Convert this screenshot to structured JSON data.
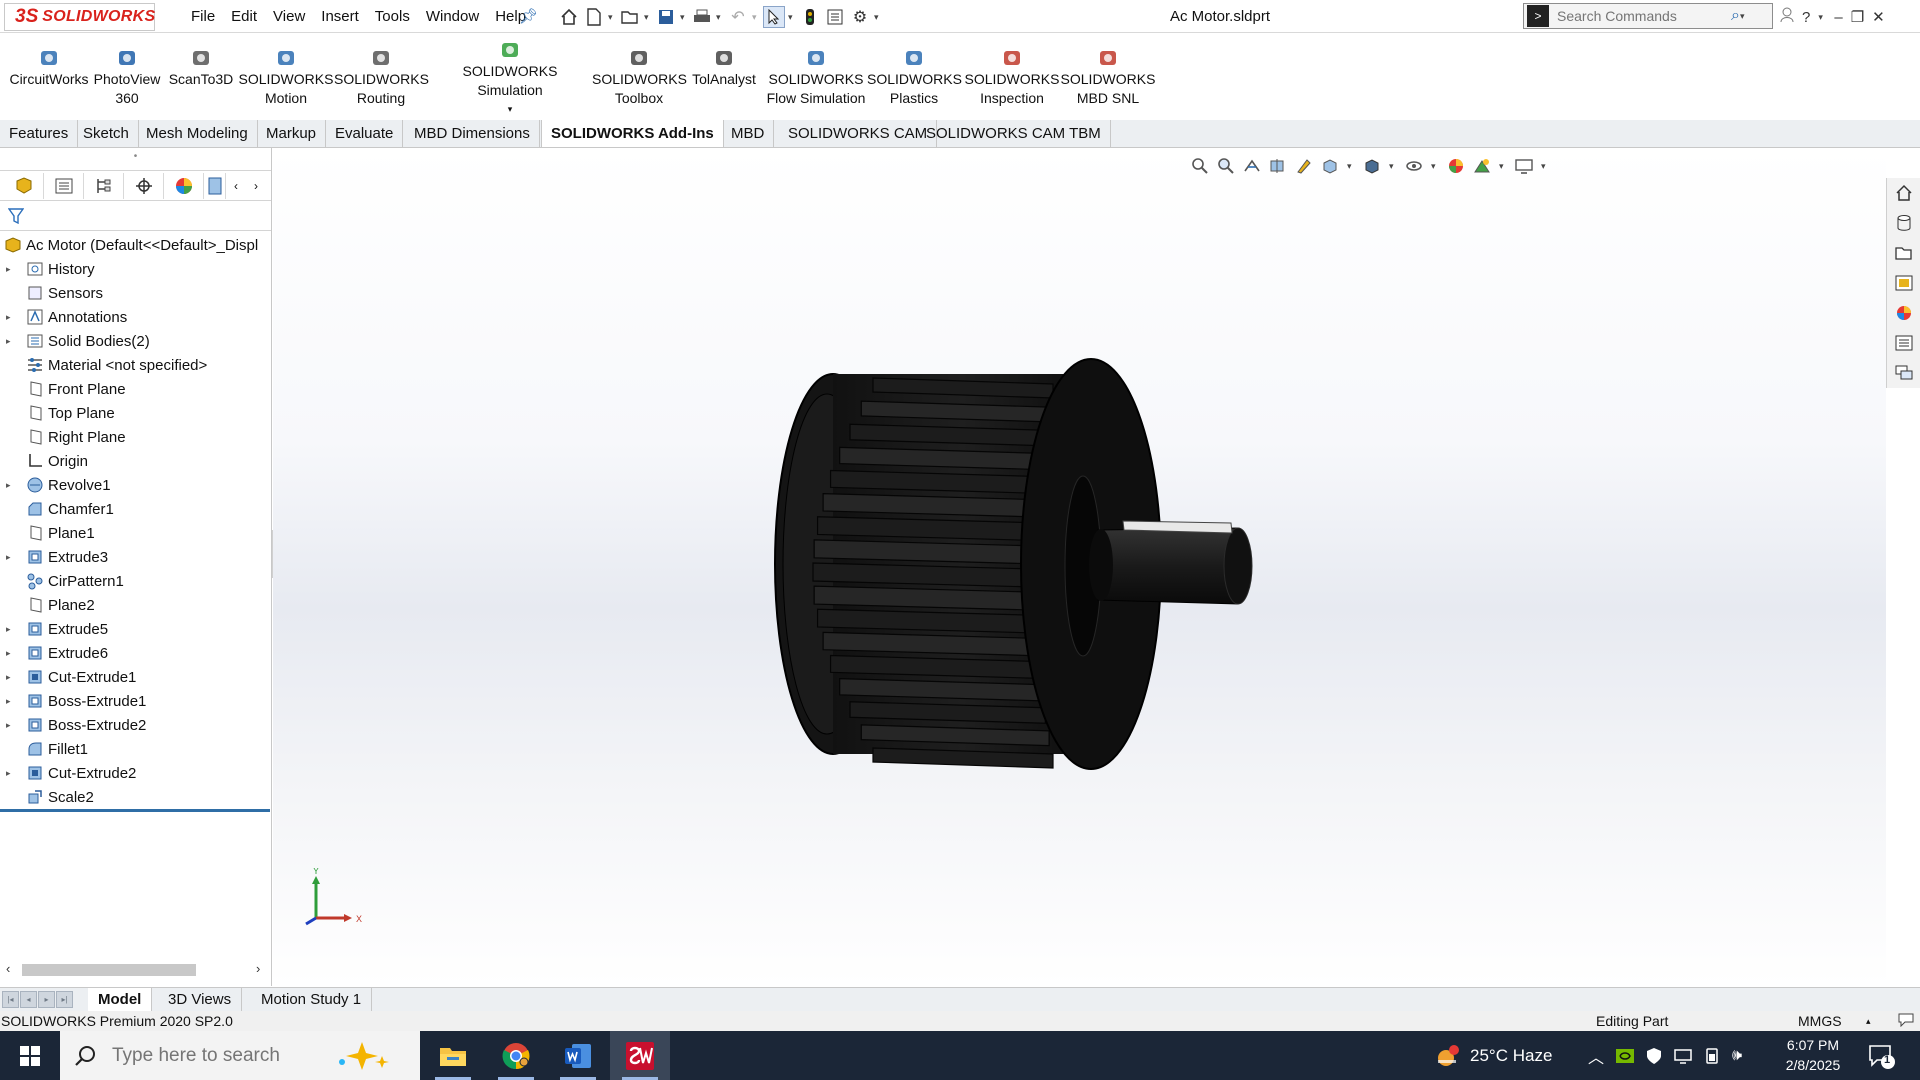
{
  "app": {
    "brand": "SOLIDWORKS",
    "document_title": "Ac Motor.sldprt"
  },
  "menu": [
    "File",
    "Edit",
    "View",
    "Insert",
    "Tools",
    "Window",
    "Help"
  ],
  "search": {
    "placeholder": "Search Commands"
  },
  "ribbon": [
    {
      "line1": "CircuitWorks",
      "line2": "",
      "icon": "circuitworks-icon",
      "color": "#2b6cb0"
    },
    {
      "line1": "PhotoView",
      "line2": "360",
      "icon": "photoview-icon",
      "color": "#1f5fa8"
    },
    {
      "line1": "ScanTo3D",
      "line2": "",
      "icon": "scanto3d-icon",
      "color": "#555555"
    },
    {
      "line1": "SOLIDWORKS",
      "line2": "Motion",
      "icon": "motion-icon",
      "color": "#2b6cb0"
    },
    {
      "line1": "SOLIDWORKS",
      "line2": "Routing",
      "icon": "routing-icon",
      "color": "#555555"
    },
    {
      "line1": "SOLIDWORKS Simulation",
      "line2": "",
      "icon": "simulation-icon",
      "color": "#2e9d3a"
    },
    {
      "line1": "SOLIDWORKS",
      "line2": "Toolbox",
      "icon": "toolbox-icon",
      "color": "#444444"
    },
    {
      "line1": "TolAnalyst",
      "line2": "",
      "icon": "tolanalyst-icon",
      "color": "#444444"
    },
    {
      "line1": "SOLIDWORKS",
      "line2": "Flow Simulation",
      "icon": "flow-simulation-icon",
      "color": "#2b6cb0"
    },
    {
      "line1": "SOLIDWORKS",
      "line2": "Plastics",
      "icon": "plastics-icon",
      "color": "#2b6cb0"
    },
    {
      "line1": "SOLIDWORKS",
      "line2": "Inspection",
      "icon": "inspection-icon",
      "color": "#c0392b"
    },
    {
      "line1": "SOLIDWORKS",
      "line2": "MBD SNL",
      "icon": "mbd-snl-icon",
      "color": "#c0392b"
    }
  ],
  "tabs": [
    "Features",
    "Sketch",
    "Mesh Modeling",
    "Markup",
    "Evaluate",
    "MBD Dimensions",
    "SOLIDWORKS Add-Ins",
    "MBD",
    "SOLIDWORKS CAM",
    "SOLIDWORKS CAM TBM"
  ],
  "active_tab": "SOLIDWORKS Add-Ins",
  "tree": {
    "root": "Ac Motor  (Default<<Default>_Displ",
    "items": [
      {
        "label": "History",
        "icon": "history-folder-icon",
        "expandable": true
      },
      {
        "label": "Sensors",
        "icon": "sensors-icon",
        "expandable": false
      },
      {
        "label": "Annotations",
        "icon": "annotations-icon",
        "expandable": true
      },
      {
        "label": "Solid Bodies(2)",
        "icon": "solid-bodies-icon",
        "expandable": true
      },
      {
        "label": "Material <not specified>",
        "icon": "material-icon",
        "expandable": false
      },
      {
        "label": "Front Plane",
        "icon": "plane-icon",
        "expandable": false
      },
      {
        "label": "Top Plane",
        "icon": "plane-icon",
        "expandable": false
      },
      {
        "label": "Right Plane",
        "icon": "plane-icon",
        "expandable": false
      },
      {
        "label": "Origin",
        "icon": "origin-icon",
        "expandable": false
      },
      {
        "label": "Revolve1",
        "icon": "revolve-icon",
        "expandable": true
      },
      {
        "label": "Chamfer1",
        "icon": "chamfer-icon",
        "expandable": false
      },
      {
        "label": "Plane1",
        "icon": "plane-icon",
        "expandable": false
      },
      {
        "label": "Extrude3",
        "icon": "extrude-icon",
        "expandable": true
      },
      {
        "label": "CirPattern1",
        "icon": "circular-pattern-icon",
        "expandable": false
      },
      {
        "label": "Plane2",
        "icon": "plane-icon",
        "expandable": false
      },
      {
        "label": "Extrude5",
        "icon": "extrude-icon",
        "expandable": true
      },
      {
        "label": "Extrude6",
        "icon": "extrude-icon",
        "expandable": true
      },
      {
        "label": "Cut-Extrude1",
        "icon": "cut-extrude-icon",
        "expandable": true
      },
      {
        "label": "Boss-Extrude1",
        "icon": "extrude-icon",
        "expandable": true
      },
      {
        "label": "Boss-Extrude2",
        "icon": "extrude-icon",
        "expandable": true
      },
      {
        "label": "Fillet1",
        "icon": "fillet-icon",
        "expandable": false
      },
      {
        "label": "Cut-Extrude2",
        "icon": "cut-extrude-icon",
        "expandable": true
      },
      {
        "label": "Scale2",
        "icon": "scale-icon",
        "expandable": false
      }
    ]
  },
  "triad": {
    "x": "X",
    "y": "Y"
  },
  "bottom_tabs": [
    "Model",
    "3D Views",
    "Motion Study 1"
  ],
  "active_bottom_tab": "Model",
  "status": {
    "product": "SOLIDWORKS Premium 2020 SP2.0",
    "mode": "Editing Part",
    "units": "MMGS"
  },
  "taskbar": {
    "search_placeholder": "Type here to search",
    "weather": "25°C  Haze",
    "time": "6:07 PM",
    "date": "2/8/2025",
    "notification_count": "1",
    "apps": [
      "file-explorer-icon",
      "chrome-icon",
      "word-icon",
      "solidworks-2020-icon"
    ]
  },
  "colors": {
    "brand_red": "#d9221c",
    "model_body": "#1a1a1a",
    "selection_blue": "#2f6ea6",
    "taskbar": "#1b2637"
  }
}
